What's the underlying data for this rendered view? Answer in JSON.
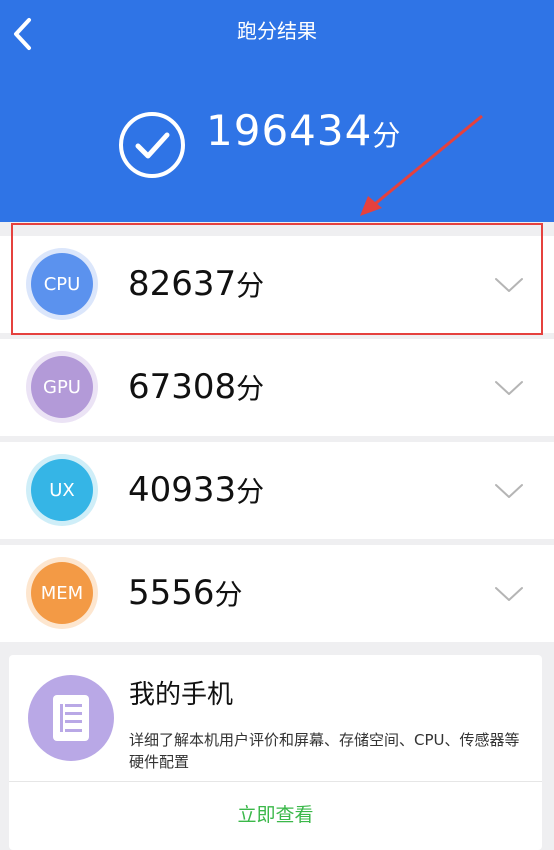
{
  "header": {
    "title": "跑分结果",
    "total_score": "196434",
    "total_unit": "分",
    "color": "#2f74e6"
  },
  "scores": [
    {
      "label": "CPU",
      "score": "82637",
      "unit": "分",
      "color": "#5b92ee",
      "ring": "#dbe6fb"
    },
    {
      "label": "GPU",
      "score": "67308",
      "unit": "分",
      "color": "#b39ad8",
      "ring": "#ebe3f5"
    },
    {
      "label": "UX",
      "score": "40933",
      "unit": "分",
      "color": "#35b5e6",
      "ring": "#cfeef8"
    },
    {
      "label": "MEM",
      "score": "5556",
      "unit": "分",
      "color": "#f39a45",
      "ring": "#fde6cf"
    }
  ],
  "card": {
    "title": "我的手机",
    "description": "详细了解本机用户评价和屏幕、存储空间、CPU、传感器等硬件配置",
    "link": "立即查看",
    "link_color": "#3bb84a"
  },
  "annotation": {
    "color": "#e5413e"
  }
}
